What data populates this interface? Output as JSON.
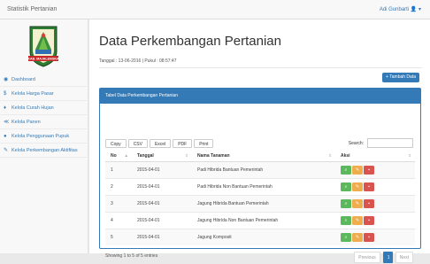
{
  "app": {
    "brand": "Statistik Pertanian",
    "user_label": "Adi Gunbarti 👤 ▾"
  },
  "logo": {
    "banner_text": "KAB. MAJALENGKA"
  },
  "sidebar": {
    "items": [
      {
        "icon": "dashboard-icon",
        "glyph": "◉",
        "label": "Dashboard"
      },
      {
        "icon": "dollar-icon",
        "glyph": "$",
        "label": "Kelola Harga Pasar"
      },
      {
        "icon": "tint-icon",
        "glyph": "♦",
        "label": "Kelola Curah Hujan"
      },
      {
        "icon": "tasks-icon",
        "glyph": "≪",
        "label": "Kelola Panen"
      },
      {
        "icon": "circle-icon",
        "glyph": "●",
        "label": "Kelola Penggunaan Pupuk"
      },
      {
        "icon": "wrench-icon",
        "glyph": "✎",
        "label": "Kelola Perkembangan Aktifitas"
      }
    ]
  },
  "main": {
    "title": "Data Perkembangan Pertanian",
    "date_line": "Tanggal : 13-06-2016 | Pukul : 08:57:47",
    "add_label": "+ Tambah Data",
    "panel_title": "Tabel Data Perkembangan Pertanian",
    "tools": [
      "Copy",
      "CSV",
      "Excel",
      "PDF",
      "Print"
    ],
    "search_label": "Search:",
    "search_value": "",
    "columns": [
      "No",
      "Tanggal",
      "Nama Tanaman",
      "Aksi"
    ],
    "rows": [
      {
        "no": "1",
        "tanggal": "2015-04-01",
        "nama": "Padi Hibrida Bantuan Pemerintah"
      },
      {
        "no": "2",
        "tanggal": "2015-04-01",
        "nama": "Padi Hibrida Non Bantuan Pemerintah"
      },
      {
        "no": "3",
        "tanggal": "2015-04-01",
        "nama": "Jagung Hibrida Bantuan Pemerintah"
      },
      {
        "no": "4",
        "tanggal": "2015-04-01",
        "nama": "Jagung Hibrida Non Bantuan Pemerintah"
      },
      {
        "no": "5",
        "tanggal": "2015-04-01",
        "nama": "Jagung Komposit"
      }
    ],
    "action_icons": [
      "search-icon",
      "edit-icon",
      "trash-icon"
    ],
    "showing": "Showing 1 to 5 of 5 entries",
    "pager": {
      "prev": "Previous",
      "current": "1",
      "next": "Next"
    }
  },
  "colors": {
    "primary": "#337ab7",
    "success": "#5cb85c",
    "warning": "#f0ad4e",
    "danger": "#d9534f"
  }
}
